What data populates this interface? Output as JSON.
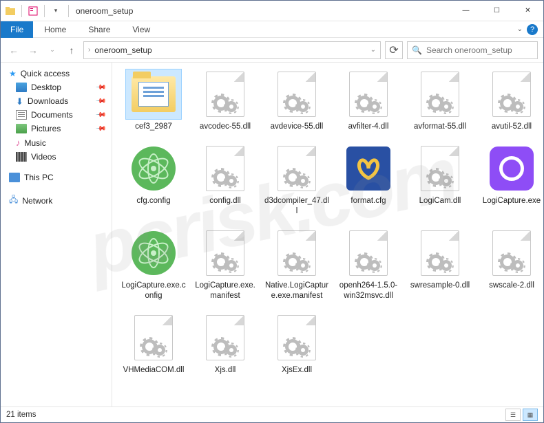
{
  "window": {
    "title": "oneroom_setup"
  },
  "ribbon": {
    "file": "File",
    "tabs": [
      "Home",
      "Share",
      "View"
    ]
  },
  "breadcrumb": {
    "path": "oneroom_setup"
  },
  "search": {
    "placeholder": "Search oneroom_setup"
  },
  "sidebar": {
    "quick": "Quick access",
    "items": [
      {
        "label": "Desktop",
        "pinned": true
      },
      {
        "label": "Downloads",
        "pinned": true
      },
      {
        "label": "Documents",
        "pinned": true
      },
      {
        "label": "Pictures",
        "pinned": true
      },
      {
        "label": "Music",
        "pinned": false
      },
      {
        "label": "Videos",
        "pinned": false
      }
    ],
    "thispc": "This PC",
    "network": "Network"
  },
  "files": [
    {
      "name": "cef3_2987",
      "icon": "folder",
      "selected": true
    },
    {
      "name": "avcodec-55.dll",
      "icon": "generic"
    },
    {
      "name": "avdevice-55.dll",
      "icon": "generic"
    },
    {
      "name": "avfilter-4.dll",
      "icon": "generic"
    },
    {
      "name": "avformat-55.dll",
      "icon": "generic"
    },
    {
      "name": "avutil-52.dll",
      "icon": "generic"
    },
    {
      "name": "cfg.config",
      "icon": "atom"
    },
    {
      "name": "config.dll",
      "icon": "generic"
    },
    {
      "name": "d3dcompiler_47.dll",
      "icon": "generic"
    },
    {
      "name": "format.cfg",
      "icon": "pretzel"
    },
    {
      "name": "LogiCam.dll",
      "icon": "generic"
    },
    {
      "name": "LogiCapture.exe",
      "icon": "purple"
    },
    {
      "name": "LogiCapture.exe.config",
      "icon": "atom"
    },
    {
      "name": "LogiCapture.exe.manifest",
      "icon": "generic"
    },
    {
      "name": "Native.LogiCapture.exe.manifest",
      "icon": "generic"
    },
    {
      "name": "openh264-1.5.0-win32msvc.dll",
      "icon": "generic"
    },
    {
      "name": "swresample-0.dll",
      "icon": "generic"
    },
    {
      "name": "swscale-2.dll",
      "icon": "generic"
    },
    {
      "name": "VHMediaCOM.dll",
      "icon": "generic"
    },
    {
      "name": "Xjs.dll",
      "icon": "generic"
    },
    {
      "name": "XjsEx.dll",
      "icon": "generic"
    }
  ],
  "status": {
    "count": "21 items"
  },
  "watermark": "pcrisk.com"
}
